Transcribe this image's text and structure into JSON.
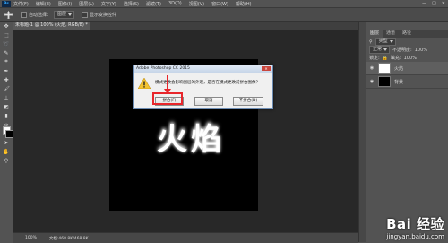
{
  "app": {
    "logo": "Ps",
    "window_controls": [
      "—",
      "□",
      "✕"
    ]
  },
  "menubar": {
    "items": [
      "文件(F)",
      "编辑(E)",
      "图像(I)",
      "图层(L)",
      "文字(Y)",
      "选择(S)",
      "滤镜(T)",
      "3D(D)",
      "视图(V)",
      "窗口(W)",
      "帮助(H)"
    ]
  },
  "options_bar": {
    "auto_select_label": "自动选择：",
    "auto_select_value": "图层",
    "show_transform_label": "显示变换控件"
  },
  "document_tab": {
    "label": "未标题-1 @ 100% (火焰, RGB/8) *"
  },
  "dialog": {
    "title": "Adobe Photoshop CC 2015",
    "close": "✕",
    "message": "模式更改会影响图层的外观，是否在模式更改前拼合图像？",
    "buttons": {
      "flatten": "拼合(F)",
      "cancel": "取消",
      "no_flatten": "不拼合(D)"
    }
  },
  "canvas_text": "火焰",
  "statusbar": {
    "zoom": "100%",
    "doc_size": "文档:468.8K/468.8K"
  },
  "layers_panel": {
    "tabs": [
      "图层",
      "通道",
      "路径"
    ],
    "filter_kind": "类型",
    "blend_mode": "正常",
    "opacity_label": "不透明度:",
    "opacity_value": "100%",
    "lock_label": "锁定:",
    "fill_label": "填充:",
    "fill_value": "100%",
    "layers": [
      {
        "name": "火焰",
        "thumb": "#ffffff"
      },
      {
        "name": "背景",
        "thumb": "#000000"
      }
    ]
  },
  "watermark": {
    "logo": "Bai 经验",
    "url": "jingyan.baidu.com"
  },
  "colors": {
    "highlight": "#e8262b",
    "ps_dark": "#535353"
  }
}
